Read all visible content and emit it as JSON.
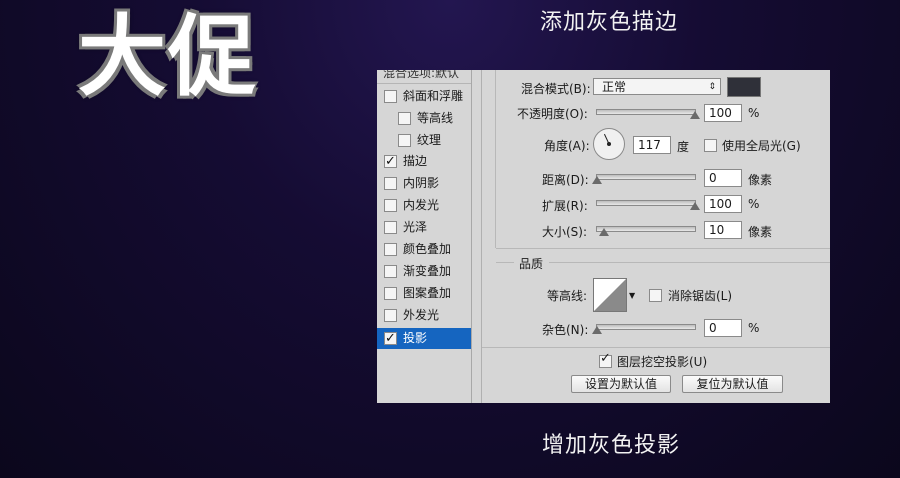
{
  "banner": {
    "title": "大促"
  },
  "captions": {
    "top": "添加灰色描边",
    "bottom": "增加灰色投影"
  },
  "styles_list": {
    "header": "混合选项:默认",
    "items": [
      {
        "label": "斜面和浮雕",
        "checked": false
      },
      {
        "label": "等高线",
        "checked": false
      },
      {
        "label": "纹理",
        "checked": false
      },
      {
        "label": "描边",
        "checked": true
      },
      {
        "label": "内阴影",
        "checked": false
      },
      {
        "label": "内发光",
        "checked": false
      },
      {
        "label": "光泽",
        "checked": false
      },
      {
        "label": "颜色叠加",
        "checked": false
      },
      {
        "label": "渐变叠加",
        "checked": false
      },
      {
        "label": "图案叠加",
        "checked": false
      },
      {
        "label": "外发光",
        "checked": false
      },
      {
        "label": "投影",
        "checked": true,
        "selected": true
      }
    ]
  },
  "structure": {
    "blend_mode_label": "混合模式(B):",
    "blend_mode_value": "正常",
    "shadow_color": "#2f3039",
    "opacity_label": "不透明度(O):",
    "opacity_value": "100",
    "opacity_unit": "%",
    "angle_label": "角度(A):",
    "angle_value": "117",
    "angle_unit": "度",
    "global_light_label": "使用全局光(G)",
    "global_light_checked": false,
    "distance_label": "距离(D):",
    "distance_value": "0",
    "distance_unit": "像素",
    "spread_label": "扩展(R):",
    "spread_value": "100",
    "spread_unit": "%",
    "size_label": "大小(S):",
    "size_value": "10",
    "size_unit": "像素"
  },
  "quality": {
    "section_label": "品质",
    "contour_label": "等高线:",
    "antialias_label": "消除锯齿(L)",
    "antialias_checked": false,
    "noise_label": "杂色(N):",
    "noise_value": "0",
    "noise_unit": "%"
  },
  "footer": {
    "knockout_label": "图层挖空投影(U)",
    "knockout_checked": true,
    "default_button": "设置为默认值",
    "reset_button": "复位为默认值"
  }
}
